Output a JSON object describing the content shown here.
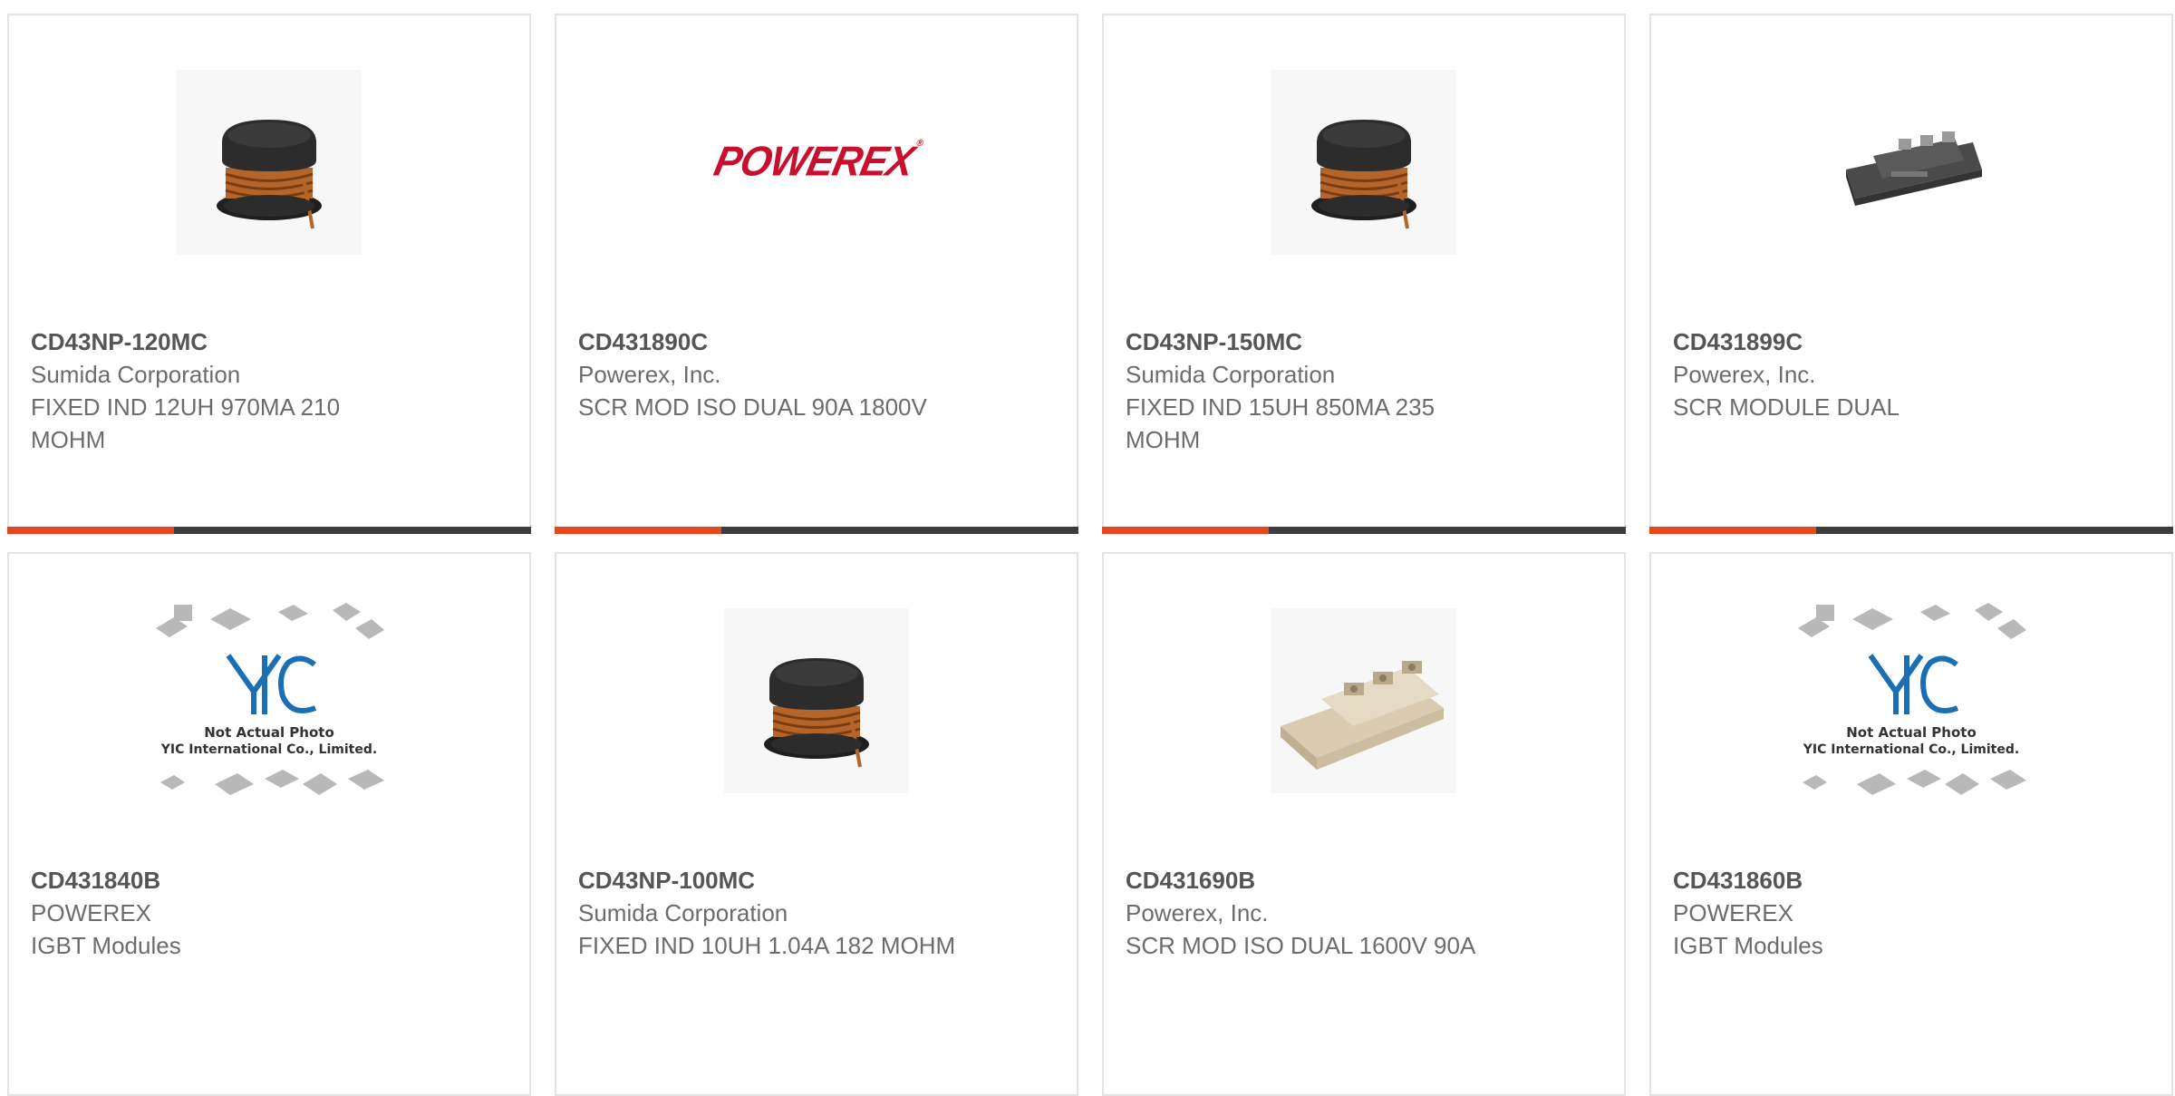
{
  "cards": [
    {
      "part": "CD43NP-120MC",
      "mfr": "Sumida Corporation",
      "desc": "FIXED IND 12UH 970MA 210 MOHM",
      "image": "inductor-coil"
    },
    {
      "part": "CD431890C",
      "mfr": "Powerex, Inc.",
      "desc": "SCR MOD ISO DUAL 90A 1800V",
      "image": "powerex-logo"
    },
    {
      "part": "CD43NP-150MC",
      "mfr": "Sumida Corporation",
      "desc": "FIXED IND 15UH 850MA 235 MOHM",
      "image": "inductor-coil"
    },
    {
      "part": "CD431899C",
      "mfr": "Powerex, Inc.",
      "desc": "SCR MODULE DUAL",
      "image": "dark-scr-module"
    },
    {
      "part": "CD431840B",
      "mfr": "POWEREX",
      "desc": "IGBT Modules",
      "image": "yic-placeholder"
    },
    {
      "part": "CD43NP-100MC",
      "mfr": "Sumida Corporation",
      "desc": "FIXED IND 10UH 1.04A 182 MOHM",
      "image": "inductor-coil"
    },
    {
      "part": "CD431690B",
      "mfr": "Powerex, Inc.",
      "desc": "SCR MOD ISO DUAL 1600V 90A",
      "image": "beige-scr-module"
    },
    {
      "part": "CD431860B",
      "mfr": "POWEREX",
      "desc": "IGBT Modules",
      "image": "yic-placeholder"
    }
  ],
  "logos": {
    "powerex": "POWEREX",
    "yic_line1": "Not Actual Photo",
    "yic_line2": "YIC International Co., Limited."
  },
  "colors": {
    "accent": "#e8461e",
    "bar": "#3d3d3d",
    "powerex_red": "#c8102e",
    "yic_blue": "#1a6fb5"
  }
}
